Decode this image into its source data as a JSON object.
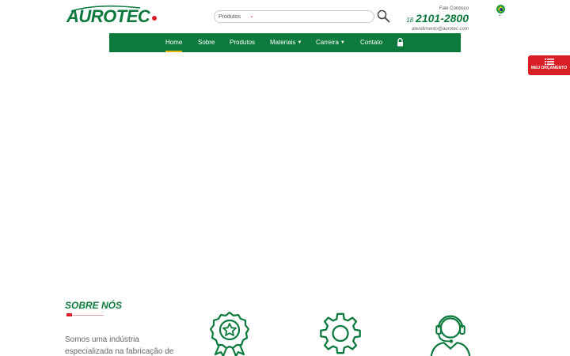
{
  "brand": {
    "logo_text": "AUROTEC",
    "colors": {
      "primary_green": "#0c7a3c",
      "accent_red": "#d81f26",
      "active_yellow": "#f0b400"
    }
  },
  "header": {
    "search": {
      "category_selected": "Produtos",
      "placeholder": ""
    },
    "contact": {
      "label": "Fale Conosco",
      "ddd": "18",
      "phone": "2101-2800",
      "email": "atendimento@aurotec.com"
    },
    "language": {
      "flag": "brazil-flag-icon"
    }
  },
  "nav": {
    "items": [
      {
        "label": "Home",
        "active": true,
        "dropdown": false
      },
      {
        "label": "Sobre",
        "active": false,
        "dropdown": false
      },
      {
        "label": "Produtos",
        "active": false,
        "dropdown": false
      },
      {
        "label": "Materiais",
        "active": false,
        "dropdown": true
      },
      {
        "label": "Carreira",
        "active": false,
        "dropdown": true
      },
      {
        "label": "Contato",
        "active": false,
        "dropdown": false
      }
    ],
    "lock_icon": "lock-icon"
  },
  "quote_button": {
    "label": "MEU ORÇAMENTO",
    "icon": "list-icon"
  },
  "about": {
    "title": "SOBRE NÓS",
    "text": "Somos uma indústria especializada na fabricação de",
    "features": [
      {
        "icon": "award-medal-icon"
      },
      {
        "icon": "gear-icon"
      },
      {
        "icon": "support-headset-icon"
      }
    ]
  }
}
